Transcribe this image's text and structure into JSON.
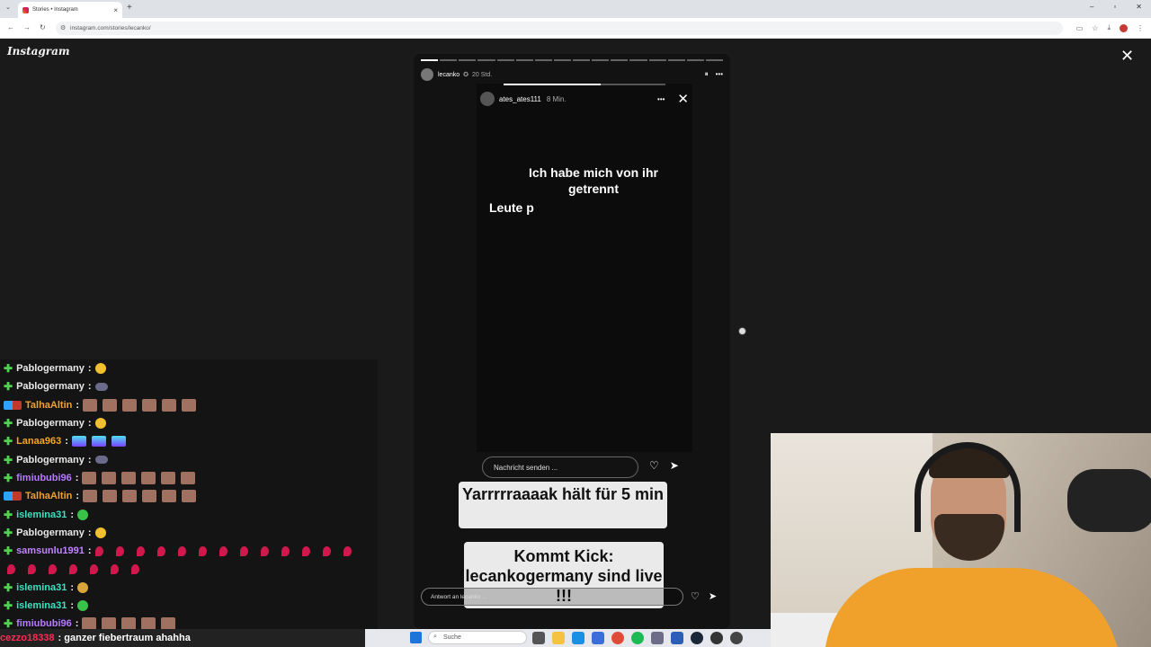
{
  "browser": {
    "tab_title": "Stories • Instagram",
    "new_tab": "+",
    "tab_close": "×",
    "url": "instagram.com/stories/lecanko/"
  },
  "instagram": {
    "logo": "Instagram",
    "close": "✕"
  },
  "story": {
    "username": "lecanko",
    "time": "20 Std.",
    "pause": "⏸",
    "more": "•••",
    "inner_username": "ates_ates111",
    "inner_time": "8 Min.",
    "inner_more": "•••",
    "inner_close": "✕",
    "text_main": "Ich habe mich von ihr getrennt",
    "text_second": "Leute p",
    "send_placeholder": "Nachricht senden ...",
    "caption_1": "Yarrrrraaaak hält für 5 min",
    "caption_2": "Kommt Kick: lecankogermany sind live !!!",
    "reply_placeholder": "Antwort an lecanko ..."
  },
  "chat": {
    "rows": [
      {
        "user": "Pablogermany",
        "color": "#e8e8e8",
        "emote": "sun",
        "count": 1
      },
      {
        "user": "Pablogermany",
        "color": "#e8e8e8",
        "emote": "cloud",
        "count": 1
      },
      {
        "user": "TalhaAltin",
        "color": "#f0a030",
        "emote": "face",
        "count": 6,
        "badge": true
      },
      {
        "user": "Pablogermany",
        "color": "#e8e8e8",
        "emote": "sun",
        "count": 1
      },
      {
        "user": "Lanaa963",
        "color": "#f5a623",
        "emote": "bars",
        "count": 3
      },
      {
        "user": "Pablogermany",
        "color": "#e8e8e8",
        "emote": "cloud",
        "count": 1
      },
      {
        "user": "fimiububi96",
        "color": "#b77bff",
        "emote": "face",
        "count": 6
      },
      {
        "user": "TalhaAltin",
        "color": "#f0a030",
        "emote": "face",
        "count": 6,
        "badge": true
      },
      {
        "user": "islemina31",
        "color": "#3ce0c0",
        "emote": "green",
        "count": 1
      },
      {
        "user": "Pablogermany",
        "color": "#e8e8e8",
        "emote": "sun",
        "count": 1
      },
      {
        "user": "samsunlu1991",
        "color": "#c084ff",
        "emote": "drop",
        "count": 13
      },
      {
        "user": "",
        "color": "#e8e8e8",
        "emote": "drop",
        "count": 7,
        "continuation": true
      },
      {
        "user": "islemina31",
        "color": "#3ce0c0",
        "emote": "cry",
        "count": 1
      },
      {
        "user": "islemina31",
        "color": "#3ce0c0",
        "emote": "green",
        "count": 1
      },
      {
        "user": "fimiububi96",
        "color": "#b77bff",
        "emote": "face",
        "count": 5
      }
    ],
    "separator": ":"
  },
  "bottom_chat": {
    "user": "cezzo18338",
    "message": ": ganzer fiebertraum ahahha"
  },
  "taskbar": {
    "search": "Suche"
  },
  "colors": {
    "instagram_bg": "#1a1a1a",
    "chat_plus": "#53d155",
    "caption_bg": "#eaeaea",
    "shirt": "#f0a12b"
  }
}
